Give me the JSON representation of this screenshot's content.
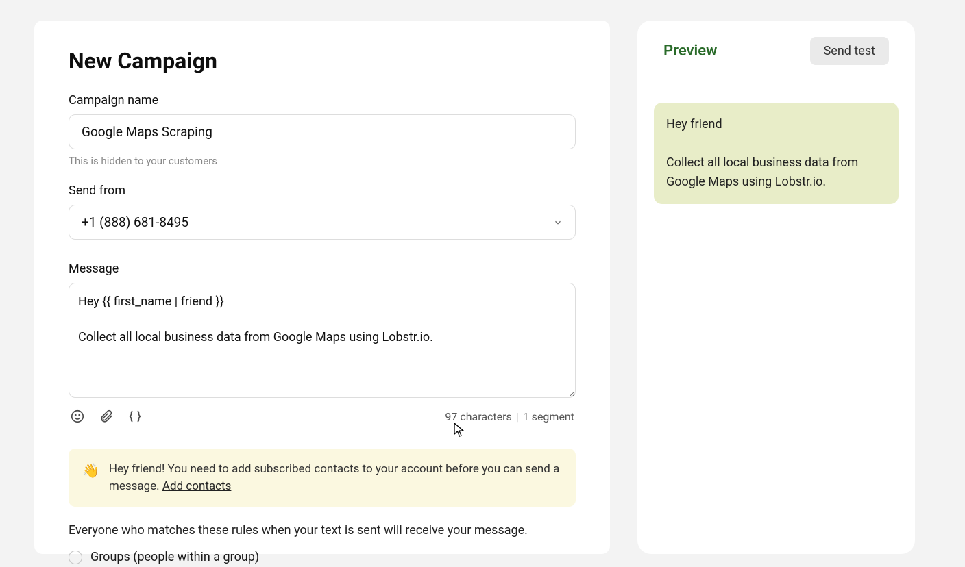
{
  "page": {
    "title": "New Campaign"
  },
  "campaign_name": {
    "label": "Campaign name",
    "value": "Google Maps Scraping",
    "helper": "This is hidden to your customers"
  },
  "send_from": {
    "label": "Send from",
    "selected": "+1 (888) 681-8495"
  },
  "message": {
    "label": "Message",
    "value": "Hey {{ first_name | friend }}\n\nCollect all local business data from Google Maps using Lobstr.io.",
    "char_count": "97 characters",
    "segment_count": "1 segment"
  },
  "alert": {
    "emoji": "👋",
    "text": "Hey friend! You need to add subscribed contacts to your account before you can send a message. ",
    "link": "Add contacts"
  },
  "rules": {
    "heading": "Everyone who matches these rules when your text is sent will receive your message.",
    "options": [
      "Groups (people within a group)"
    ]
  },
  "preview": {
    "title": "Preview",
    "button": "Send test",
    "bubble": "Hey friend\n\nCollect all local business data from Google Maps using Lobstr.io."
  }
}
